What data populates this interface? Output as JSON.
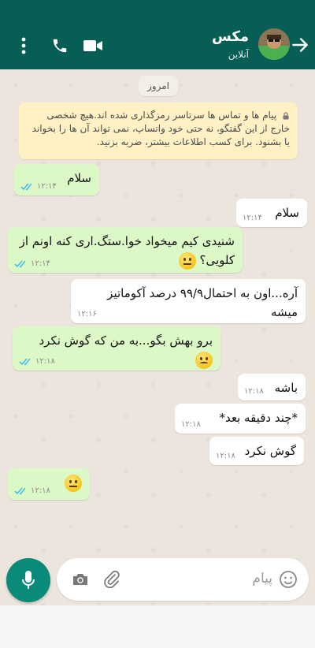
{
  "header": {
    "contact_name": "مکس",
    "status": "آنلاین",
    "colors": {
      "bar": "#075e54"
    }
  },
  "chat": {
    "date_chip": "امروز",
    "encryption_notice": "پیام ها و تماس ها سرتاسر رمزگذاری شده اند.هیچ شخصی خارج از این گفتگو، نه حتی خود واتساپ، نمی تواند آن ها را بخواند یا بشنود. برای کسب اطلاعات بیشتر، ضربه بزنید.",
    "messages": [
      {
        "dir": "out",
        "text": "سلام",
        "time": "۱۲:۱۴",
        "ticks": "read"
      },
      {
        "dir": "in",
        "text": "سلام",
        "time": "۱۲:۱۴"
      },
      {
        "dir": "out",
        "text": "شنیدی کیم میخواد خوا.ستگ.اری کنه اونم از کلویی؟",
        "emoji": "neutral-face",
        "time": "۱۲:۱۴",
        "ticks": "read"
      },
      {
        "dir": "in",
        "text": "آره...اون به احتمال۹۹/۹ درصد آکوماتیز میشه",
        "time": "۱۲:۱۶"
      },
      {
        "dir": "out",
        "text": "برو بهش بگو...به من که گوش نکرد",
        "emoji": "confused-face",
        "time": "۱۲:۱۸",
        "ticks": "read"
      },
      {
        "dir": "in",
        "text": "باشه",
        "time": "۱۲:۱۸"
      },
      {
        "dir": "in",
        "text": "*چند دقیقه بعد*",
        "time": "۱۲:۱۸"
      },
      {
        "dir": "in",
        "text": "گوش نکرد",
        "time": "۱۲:۱۸"
      },
      {
        "dir": "out",
        "text": "",
        "emoji": "neutral-face",
        "time": "۱۲:۱۸",
        "ticks": "read"
      }
    ]
  },
  "composer": {
    "placeholder": "پیام",
    "colors": {
      "mic_button": "#0a8a78"
    }
  },
  "icons": [
    "back-arrow-icon",
    "video-call-icon",
    "phone-icon",
    "more-vert-icon",
    "lock-icon",
    "double-check-icon",
    "emoji-icon",
    "attach-icon",
    "camera-icon",
    "mic-icon"
  ]
}
